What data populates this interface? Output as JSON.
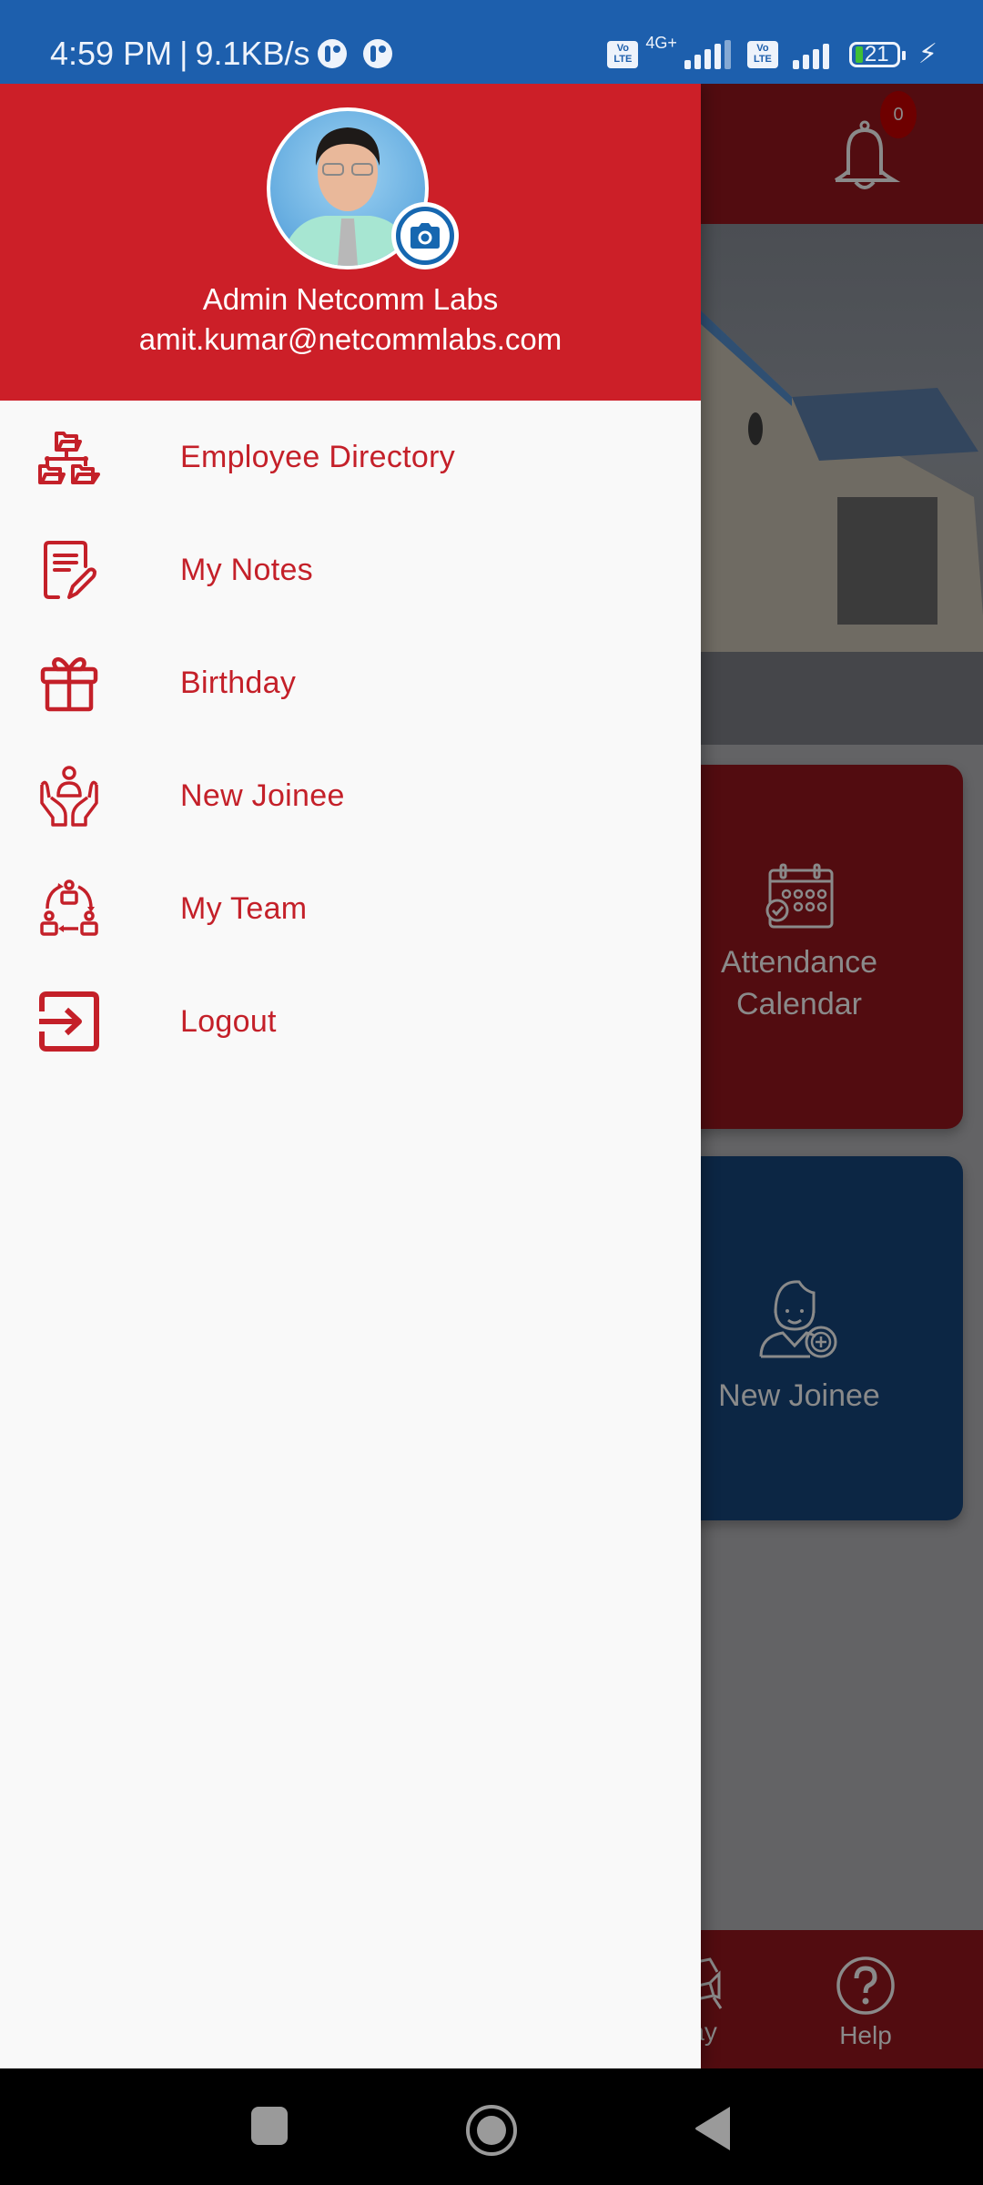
{
  "status_bar": {
    "time": "4:59 PM",
    "separator": "|",
    "net_speed": "9.1KB/s",
    "sim1_badge": "Vo LTE",
    "sim1_network": "4G+",
    "sim2_badge": "Vo LTE",
    "battery_level": "21",
    "charging": true
  },
  "drawer": {
    "header": {
      "user_name": "Admin Netcomm Labs",
      "user_email": "amit.kumar@netcommlabs.com",
      "avatar_icon": "profile-photo",
      "camera_icon": "camera-icon"
    },
    "menu": [
      {
        "label": "Employee Directory",
        "icon": "org-chart-folders-icon"
      },
      {
        "label": "My Notes",
        "icon": "note-edit-icon"
      },
      {
        "label": "Birthday",
        "icon": "gift-icon"
      },
      {
        "label": "New Joinee",
        "icon": "hands-person-icon"
      },
      {
        "label": "My Team",
        "icon": "team-cycle-icon"
      },
      {
        "label": "Logout",
        "icon": "logout-icon"
      }
    ]
  },
  "background": {
    "notification_count": "0",
    "tiles": [
      {
        "label_line1": "Attendance",
        "label_line2": "Calendar",
        "icon": "calendar-check-icon"
      },
      {
        "label_line1": "New Joinee",
        "label_line2": "",
        "icon": "new-employee-icon"
      }
    ],
    "bottom_nav": [
      {
        "label": "lay",
        "icon": "holiday-chair-icon"
      },
      {
        "label": "Help",
        "icon": "help-icon"
      }
    ]
  },
  "colors": {
    "status_bar": "#1d5fad",
    "drawer_header": "#cc1f28",
    "menu_text": "#c42029",
    "drawer_bg": "#f9f9f9",
    "camera_accent": "#1667b0",
    "dim_overlay": "#636365"
  }
}
